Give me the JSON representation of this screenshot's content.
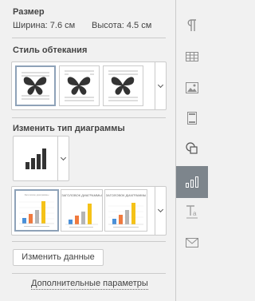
{
  "size": {
    "title": "Размер",
    "width_label": "Ширина: 7.6 см",
    "height_label": "Высота: 4.5 см"
  },
  "wrap": {
    "title": "Стиль обтекания",
    "options": [
      "wrap-square",
      "wrap-tight",
      "wrap-through"
    ]
  },
  "chart_type": {
    "title": "Изменить тип диаграммы",
    "selected": "bar-chart-icon"
  },
  "chart_styles": {
    "thumbnails": [
      {
        "title": "Заголовок диаграммы",
        "selected": true
      },
      {
        "title": "ЗАГОЛОВОК ДИАГРАММЫ",
        "selected": false
      },
      {
        "title": "ЗАГОЛОВОК ДИАГРАММЫ",
        "selected": false
      }
    ]
  },
  "edit_data_button": "Изменить данные",
  "advanced_link": "Дополнительные параметры",
  "rail": {
    "icons": [
      "paragraph-icon",
      "table-icon",
      "image-icon",
      "header-footer-icon",
      "shape-icon",
      "chart-icon",
      "text-art-icon",
      "mail-merge-icon"
    ],
    "active": "chart-icon"
  },
  "colors": {
    "accent_selected_border": "#8ea2b8",
    "rail_active": "#7d858c",
    "bar_blue": "#4a90d9",
    "bar_orange": "#f07a3e",
    "bar_gray": "#b5b5b5",
    "bar_yellow": "#f5c218"
  }
}
